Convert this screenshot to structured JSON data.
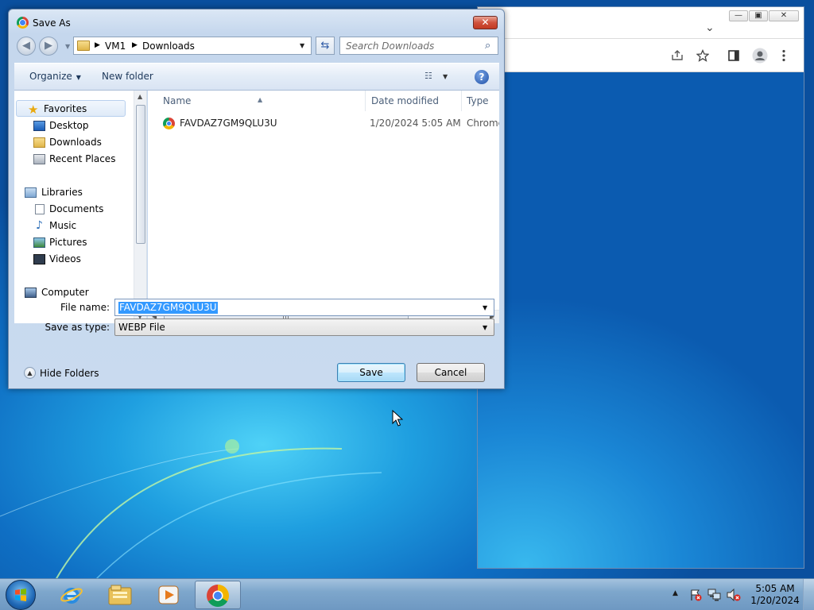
{
  "dialog": {
    "title": "Save As",
    "close_glyph": "✕",
    "nav_back_glyph": "◀",
    "nav_forward_glyph": "▶",
    "breadcrumb": [
      "VM1",
      "Downloads"
    ],
    "search_placeholder": "Search Downloads",
    "toolbar": {
      "organize": "Organize",
      "new_folder": "New folder"
    },
    "nav_pane": {
      "favorites": "Favorites",
      "favorites_items": [
        "Desktop",
        "Downloads",
        "Recent Places"
      ],
      "libraries": "Libraries",
      "libraries_items": [
        "Documents",
        "Music",
        "Pictures",
        "Videos"
      ],
      "computer": "Computer"
    },
    "columns": {
      "name": "Name",
      "date_modified": "Date modified",
      "type": "Type"
    },
    "files": [
      {
        "name": "FAVDAZ7GM9QLU3U",
        "date_modified": "1/20/2024 5:05 AM",
        "type": "Chrome H"
      }
    ],
    "file_name_label": "File name:",
    "file_name_value": "FAVDAZ7GM9QLU3U",
    "save_as_type_label": "Save as type:",
    "save_as_type_value": "WEBP File",
    "hide_folders": "Hide Folders",
    "save_button": "Save",
    "cancel_button": "Cancel"
  },
  "chrome_window": {
    "minimize_glyph": "—",
    "maximize_glyph": "▣",
    "close_glyph": "✕",
    "tab_list_glyph": "⌄"
  },
  "taskbar": {
    "clock_time": "5:05 AM",
    "clock_date": "1/20/2024"
  },
  "colors": {
    "accent_selection": "#3399ff",
    "close_button": "#c23a22",
    "desktop_blue": "#0f6fc4"
  }
}
